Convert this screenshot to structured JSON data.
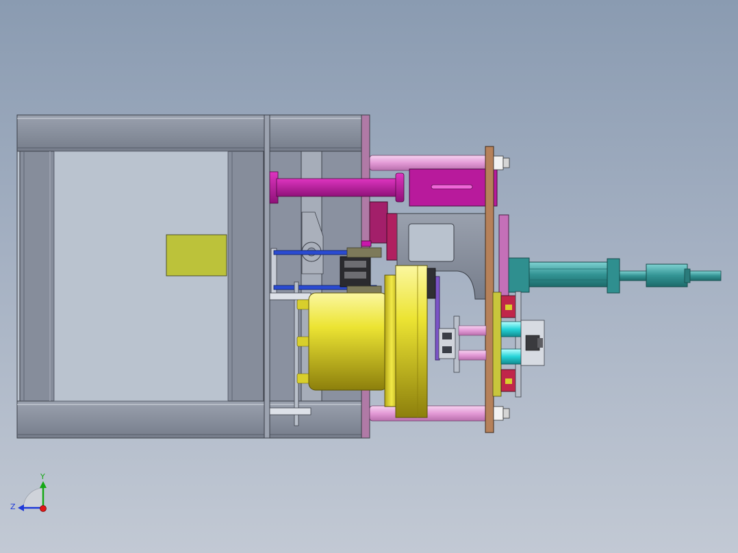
{
  "triad": {
    "y_label": "Y",
    "z_label": "Z",
    "colors": {
      "y": "#16a816",
      "z": "#1f39d8",
      "x": "#e01515"
    }
  },
  "palette": {
    "frame": "#858c9b",
    "frame_dark": "#5c6270",
    "yellow": "#e9e24a",
    "magenta": "#c21aa5",
    "pink": "#e6a4dc",
    "teal": "#3a9b9b",
    "copper": "#b07a52",
    "gray_plate": "#a6a6a8"
  }
}
